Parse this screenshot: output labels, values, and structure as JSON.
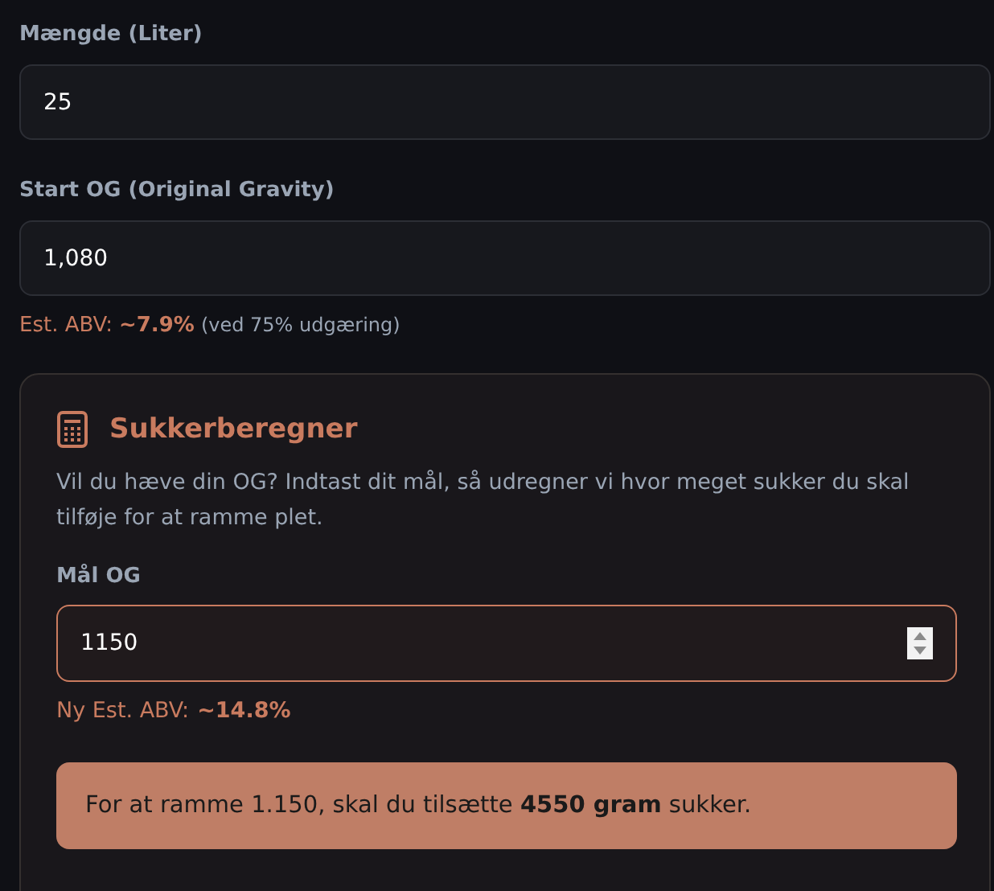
{
  "fields": [
    {
      "label": "Mængde (Liter)",
      "value": "25"
    },
    {
      "label": "Start OG (Original Gravity)",
      "value": "1,080"
    }
  ],
  "abv": {
    "label": "Est. ABV:",
    "value": "~7.9%",
    "note": "(ved 75% udgæring)"
  },
  "calculator": {
    "title": "Sukkerberegner",
    "description": "Vil du hæve din OG? Indtast dit mål, så udregner vi hvor meget sukker du skal tilføje for at ramme plet.",
    "field": {
      "label": "Mål OG",
      "value": "1150"
    },
    "abv": {
      "label": "Ny Est. ABV:",
      "value": "~14.8%"
    },
    "result": "For at ramme 1.150, skal du tilsætte **4550 gram** sukker."
  }
}
